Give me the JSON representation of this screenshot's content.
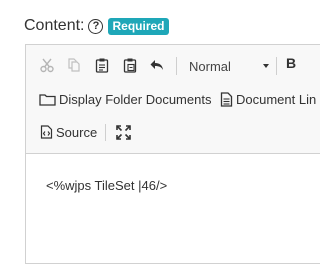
{
  "field": {
    "label": "Content:",
    "help_glyph": "?",
    "badge": "Required",
    "badge_color": "#1ea7b8"
  },
  "toolbar": {
    "row1": {
      "icons": [
        "cut-icon",
        "copy-icon",
        "paste-icon",
        "paste-text-icon",
        "undo-icon"
      ],
      "format_value": "Normal",
      "bold_label": "B"
    },
    "row2": {
      "display_folder_label": "Display Folder Documents",
      "document_link_label": "Document Lin"
    },
    "row3": {
      "source_label": "Source",
      "maximize_icon": "maximize-icon"
    }
  },
  "editor": {
    "text": "<%wjps TileSet |46/>"
  }
}
